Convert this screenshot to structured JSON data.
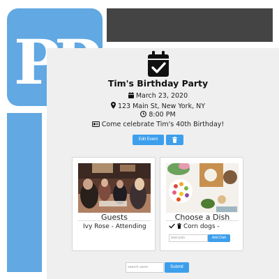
{
  "logo": {
    "text": "PP",
    "bg_color": "#62a8e2"
  },
  "event": {
    "title": "Tim's Birthday Party",
    "date": "March 23, 2020",
    "location": "123 Main St, New York, NY",
    "time": "8:00 PM",
    "description": "Come celebrate Tim's 40th Birthday!"
  },
  "actions": {
    "edit_label": "Edit Event",
    "delete_icon": "trash-icon"
  },
  "guests": {
    "title": "Guests",
    "entry": "Ivy Rose - Attending"
  },
  "dishes": {
    "title": "Choose a Dish",
    "entry": "Corn dogs -",
    "input_placeholder": "Add Dish",
    "add_label": "Add Dish"
  },
  "search": {
    "placeholder": "Search users",
    "submit_label": "Submit"
  },
  "colors": {
    "accent": "#3d9fec",
    "header": "#444444",
    "panel": "#efefef"
  }
}
